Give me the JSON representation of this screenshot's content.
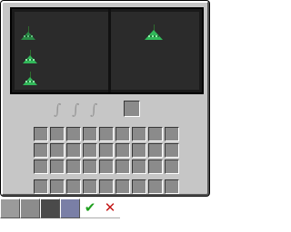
{
  "preview": {
    "left_trees": [
      "tree-sprite",
      "tree-sprite",
      "tree-sprite"
    ],
    "right_trees": [
      "tree-sprite"
    ]
  },
  "ghost_slots": [
    "∫",
    "∫",
    "∫"
  ],
  "inventory": {
    "rows": 3,
    "cols": 9
  },
  "hotbar": {
    "cols": 9
  },
  "palette": {
    "swatches": [
      "#9b9b9b",
      "#8c8c8c",
      "#4a4a4a",
      "#7a7fa6"
    ],
    "confirm_glyph": "✔",
    "cancel_glyph": "✕",
    "confirm_color": "#1fa01f",
    "cancel_color": "#c41818"
  }
}
